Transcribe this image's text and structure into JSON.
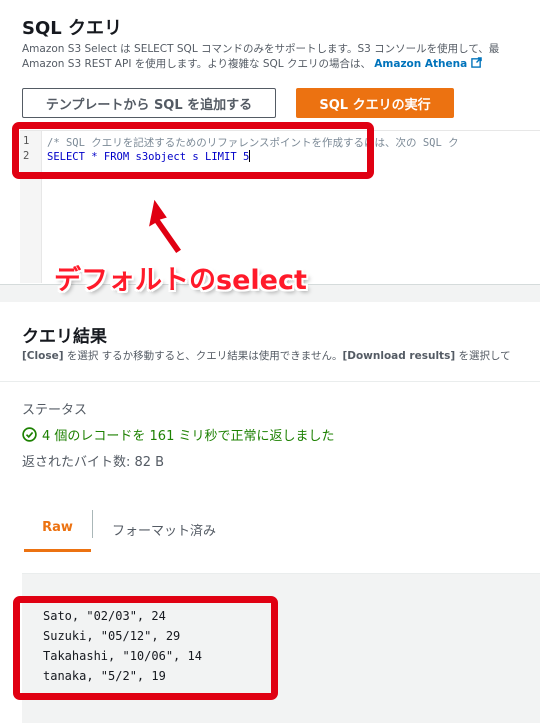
{
  "sql_panel": {
    "title": "SQL クエリ",
    "desc_line1": "Amazon S3 Select は SELECT SQL コマンドのみをサポートします。S3 コンソールを使用して、最",
    "desc_line2": "Amazon S3 REST API を使用します。より複雑な SQL クエリの場合は、",
    "link": "Amazon Athena",
    "btn_template": "テンプレートから SQL を追加する",
    "btn_run": "SQL クエリの実行",
    "editor": {
      "line_numbers": [
        "1",
        "2"
      ],
      "line1": "/* SQL クエリを記述するためのリファレンスポイントを作成するには、次の SQL ク",
      "line2": "SELECT * FROM s3object s LIMIT 5"
    }
  },
  "annotation": {
    "text": "デフォルトのselect",
    "color": "#e00012"
  },
  "results": {
    "title": "クエリ結果",
    "desc_close": "[Close]",
    "desc_mid": " を選択 するか移動すると、クエリ結果は使用できません。",
    "desc_download": "[Download results]",
    "desc_end": " を選択して",
    "status_label": "ステータス",
    "status_text": "4 個のレコードを 161 ミリ秒で正常に返しました",
    "bytes": "返されたバイト数: 82 B",
    "tabs": {
      "raw": "Raw",
      "formatted": "フォーマット済み"
    },
    "rows": [
      "Sato, \"02/03\", 24",
      "Suzuki, \"05/12\", 29",
      "Takahashi, \"10/06\", 14",
      "tanaka, \"5/2\", 19"
    ]
  },
  "colors": {
    "accent": "#ec7211",
    "success": "#1d8102",
    "link": "#0073bb",
    "annotation": "#e00012"
  }
}
